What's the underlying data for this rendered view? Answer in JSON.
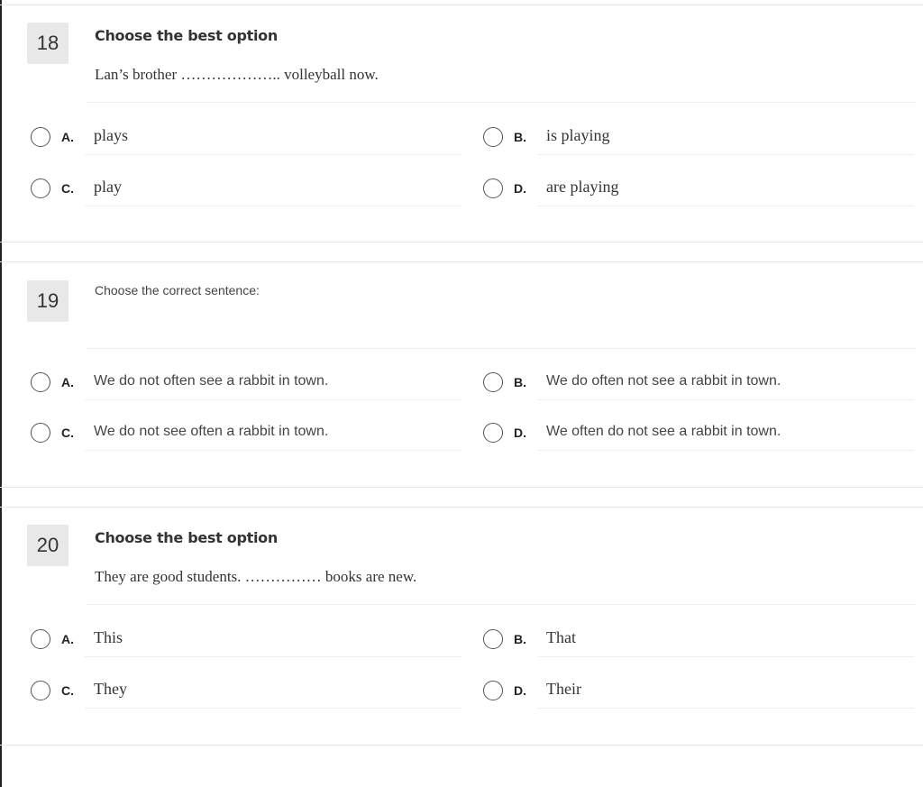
{
  "questions": [
    {
      "number": "18",
      "title": "Choose the best option",
      "text": "Lan’s brother ……………….. volleyball now.",
      "options": [
        {
          "letter": "A.",
          "text": "plays"
        },
        {
          "letter": "B.",
          "text": "is playing"
        },
        {
          "letter": "C.",
          "text": "play"
        },
        {
          "letter": "D.",
          "text": "are playing"
        }
      ]
    },
    {
      "number": "19",
      "title": "Choose the correct sentence:",
      "text": "",
      "options": [
        {
          "letter": "A.",
          "text": "We do not often see a rabbit in town."
        },
        {
          "letter": "B.",
          "text": "We do often not see a rabbit in town."
        },
        {
          "letter": "C.",
          "text": "We do not see often a rabbit in town."
        },
        {
          "letter": "D.",
          "text": "We often do not see a rabbit in town."
        }
      ]
    },
    {
      "number": "20",
      "title": "Choose the best option",
      "text": "They are good students. …………… books are new.",
      "options": [
        {
          "letter": "A.",
          "text": "This"
        },
        {
          "letter": "B.",
          "text": "That"
        },
        {
          "letter": "C.",
          "text": "They"
        },
        {
          "letter": "D.",
          "text": "Their"
        }
      ]
    }
  ]
}
